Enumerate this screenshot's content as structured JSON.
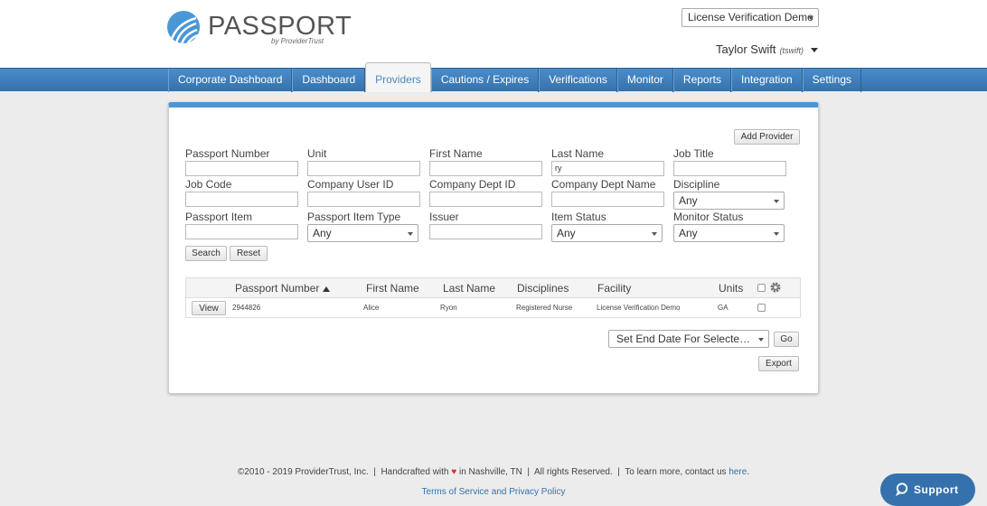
{
  "header": {
    "logo_text": "PASSPORT",
    "logo_sub": "by ProviderTrust",
    "org_select": "License Verification Demo",
    "user_name": "Taylor Swift",
    "user_handle": "(tswift)"
  },
  "nav": {
    "tabs": [
      {
        "label": "Corporate Dashboard"
      },
      {
        "label": "Dashboard"
      },
      {
        "label": "Providers",
        "active": true
      },
      {
        "label": "Cautions / Expires"
      },
      {
        "label": "Verifications"
      },
      {
        "label": "Monitor"
      },
      {
        "label": "Reports"
      },
      {
        "label": "Integration"
      },
      {
        "label": "Settings"
      }
    ]
  },
  "search": {
    "add_provider_label": "Add Provider",
    "fields": {
      "passport_number": {
        "label": "Passport Number",
        "value": ""
      },
      "unit": {
        "label": "Unit",
        "value": ""
      },
      "first_name": {
        "label": "First Name",
        "value": ""
      },
      "last_name": {
        "label": "Last Name",
        "value": "ry"
      },
      "job_title": {
        "label": "Job Title",
        "value": ""
      },
      "job_code": {
        "label": "Job Code",
        "value": ""
      },
      "company_user_id": {
        "label": "Company User ID",
        "value": ""
      },
      "company_dept_id": {
        "label": "Company Dept ID",
        "value": ""
      },
      "company_dept_name": {
        "label": "Company Dept Name",
        "value": ""
      },
      "discipline": {
        "label": "Discipline",
        "value": "Any"
      },
      "passport_item": {
        "label": "Passport Item",
        "value": ""
      },
      "passport_item_type": {
        "label": "Passport Item Type",
        "value": "Any"
      },
      "issuer": {
        "label": "Issuer",
        "value": ""
      },
      "item_status": {
        "label": "Item Status",
        "value": "Any"
      },
      "monitor_status": {
        "label": "Monitor Status",
        "value": "Any"
      }
    },
    "search_label": "Search",
    "reset_label": "Reset"
  },
  "results": {
    "columns": {
      "passport_number": "Passport Number",
      "first_name": "First Name",
      "last_name": "Last Name",
      "disciplines": "Disciplines",
      "facility": "Facility",
      "units": "Units"
    },
    "rows": [
      {
        "view_label": "View",
        "passport_number": "2944826",
        "first_name": "Alice",
        "last_name": "Ryon",
        "disciplines": "Registered Nurse",
        "facility": "License Verification Demo",
        "units": "GA"
      }
    ],
    "bulk_action": "Set End Date For Selected Providers",
    "go_label": "Go",
    "export_label": "Export"
  },
  "footer": {
    "copyright": "©2010 - 2019 ProviderTrust, Inc.",
    "handcrafted_pre": "Handcrafted with",
    "handcrafted_post": "in Nashville, TN",
    "rights": "All rights Reserved.",
    "contact_text": "To learn more, contact us",
    "contact_link": "here",
    "terms_link": "Terms of Service and Privacy Policy"
  },
  "support": {
    "label": "Support"
  },
  "colors": {
    "brand": "#4a97d6",
    "nav": "#3572ad",
    "heart": "#d9302c"
  }
}
